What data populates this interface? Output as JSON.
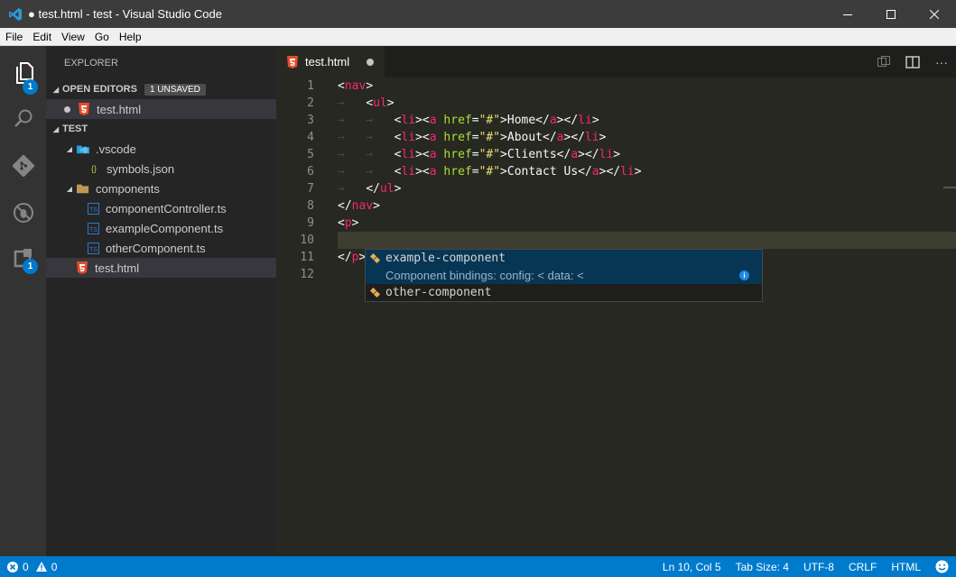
{
  "window": {
    "title": "● test.html - test - Visual Studio Code"
  },
  "menu": [
    "File",
    "Edit",
    "View",
    "Go",
    "Help"
  ],
  "activity": {
    "explorer_badge": "1",
    "extensions_badge": "1"
  },
  "sidebar": {
    "title": "EXPLORER",
    "open_editors": {
      "label": "OPEN EDITORS",
      "pill": "1 UNSAVED",
      "items": [
        "test.html"
      ]
    },
    "workspace": {
      "label": "TEST",
      "vscode_folder": ".vscode",
      "symbols_file": "symbols.json",
      "components_folder": "components",
      "files": [
        "componentController.ts",
        "exampleComponent.ts",
        "otherComponent.ts"
      ],
      "root_file": "test.html"
    }
  },
  "tab": {
    "label": "test.html"
  },
  "editor": {
    "line_numbers": [
      "1",
      "2",
      "3",
      "4",
      "5",
      "6",
      "7",
      "8",
      "9",
      "10",
      "11",
      "12"
    ],
    "lines": [
      {
        "indent": "",
        "ws": "",
        "parts": [
          [
            "pun",
            "<"
          ],
          [
            "tag",
            "nav"
          ],
          [
            "pun",
            ">"
          ]
        ]
      },
      {
        "indent": "",
        "ws": "→   ",
        "parts": [
          [
            "pun",
            "<"
          ],
          [
            "tag",
            "ul"
          ],
          [
            "pun",
            ">"
          ]
        ]
      },
      {
        "indent": "",
        "ws": "→   →   ",
        "parts": [
          [
            "pun",
            "<"
          ],
          [
            "tag",
            "li"
          ],
          [
            "pun",
            "><"
          ],
          [
            "tag",
            "a"
          ],
          [
            "pun",
            " "
          ],
          [
            "attr",
            "href"
          ],
          [
            "pun",
            "="
          ],
          [
            "str",
            "\"#\""
          ],
          [
            "pun",
            ">Home</"
          ],
          [
            "tag",
            "a"
          ],
          [
            "pun",
            "></"
          ],
          [
            "tag",
            "li"
          ],
          [
            "pun",
            ">"
          ]
        ]
      },
      {
        "indent": "",
        "ws": "→   →   ",
        "parts": [
          [
            "pun",
            "<"
          ],
          [
            "tag",
            "li"
          ],
          [
            "pun",
            "><"
          ],
          [
            "tag",
            "a"
          ],
          [
            "pun",
            " "
          ],
          [
            "attr",
            "href"
          ],
          [
            "pun",
            "="
          ],
          [
            "str",
            "\"#\""
          ],
          [
            "pun",
            ">About</"
          ],
          [
            "tag",
            "a"
          ],
          [
            "pun",
            "></"
          ],
          [
            "tag",
            "li"
          ],
          [
            "pun",
            ">"
          ]
        ]
      },
      {
        "indent": "",
        "ws": "→   →   ",
        "parts": [
          [
            "pun",
            "<"
          ],
          [
            "tag",
            "li"
          ],
          [
            "pun",
            "><"
          ],
          [
            "tag",
            "a"
          ],
          [
            "pun",
            " "
          ],
          [
            "attr",
            "href"
          ],
          [
            "pun",
            "="
          ],
          [
            "str",
            "\"#\""
          ],
          [
            "pun",
            ">Clients</"
          ],
          [
            "tag",
            "a"
          ],
          [
            "pun",
            "></"
          ],
          [
            "tag",
            "li"
          ],
          [
            "pun",
            ">"
          ]
        ]
      },
      {
        "indent": "",
        "ws": "→   →   ",
        "parts": [
          [
            "pun",
            "<"
          ],
          [
            "tag",
            "li"
          ],
          [
            "pun",
            "><"
          ],
          [
            "tag",
            "a"
          ],
          [
            "pun",
            " "
          ],
          [
            "attr",
            "href"
          ],
          [
            "pun",
            "="
          ],
          [
            "str",
            "\"#\""
          ],
          [
            "pun",
            ">Contact Us</"
          ],
          [
            "tag",
            "a"
          ],
          [
            "pun",
            "></"
          ],
          [
            "tag",
            "li"
          ],
          [
            "pun",
            ">"
          ]
        ]
      },
      {
        "indent": "",
        "ws": "→   ",
        "parts": [
          [
            "pun",
            "</"
          ],
          [
            "tag",
            "ul"
          ],
          [
            "pun",
            ">"
          ]
        ]
      },
      {
        "indent": "",
        "ws": "",
        "parts": [
          [
            "pun",
            "</"
          ],
          [
            "tag",
            "nav"
          ],
          [
            "pun",
            ">"
          ]
        ]
      },
      {
        "indent": "",
        "ws": "",
        "parts": [
          [
            "pun",
            "<"
          ],
          [
            "tag",
            "p"
          ],
          [
            "pun",
            ">"
          ]
        ]
      },
      {
        "indent": "",
        "ws": "",
        "parts": []
      },
      {
        "indent": "",
        "ws": "",
        "parts": [
          [
            "pun",
            "</"
          ],
          [
            "tag",
            "p"
          ],
          [
            "pun",
            ">"
          ]
        ]
      },
      {
        "indent": "",
        "ws": "",
        "parts": []
      }
    ]
  },
  "suggest": {
    "items": [
      "example-component",
      "other-component"
    ],
    "detail": "Component bindings: config: < data: <"
  },
  "status": {
    "errors": "0",
    "warnings": "0",
    "position": "Ln 10, Col 5",
    "tab_size": "Tab Size: 4",
    "encoding": "UTF-8",
    "eol": "CRLF",
    "language": "HTML"
  },
  "colors": {
    "accent": "#007acc",
    "tag": "#f92672",
    "attribute": "#a6e22e",
    "string": "#e6db74"
  }
}
